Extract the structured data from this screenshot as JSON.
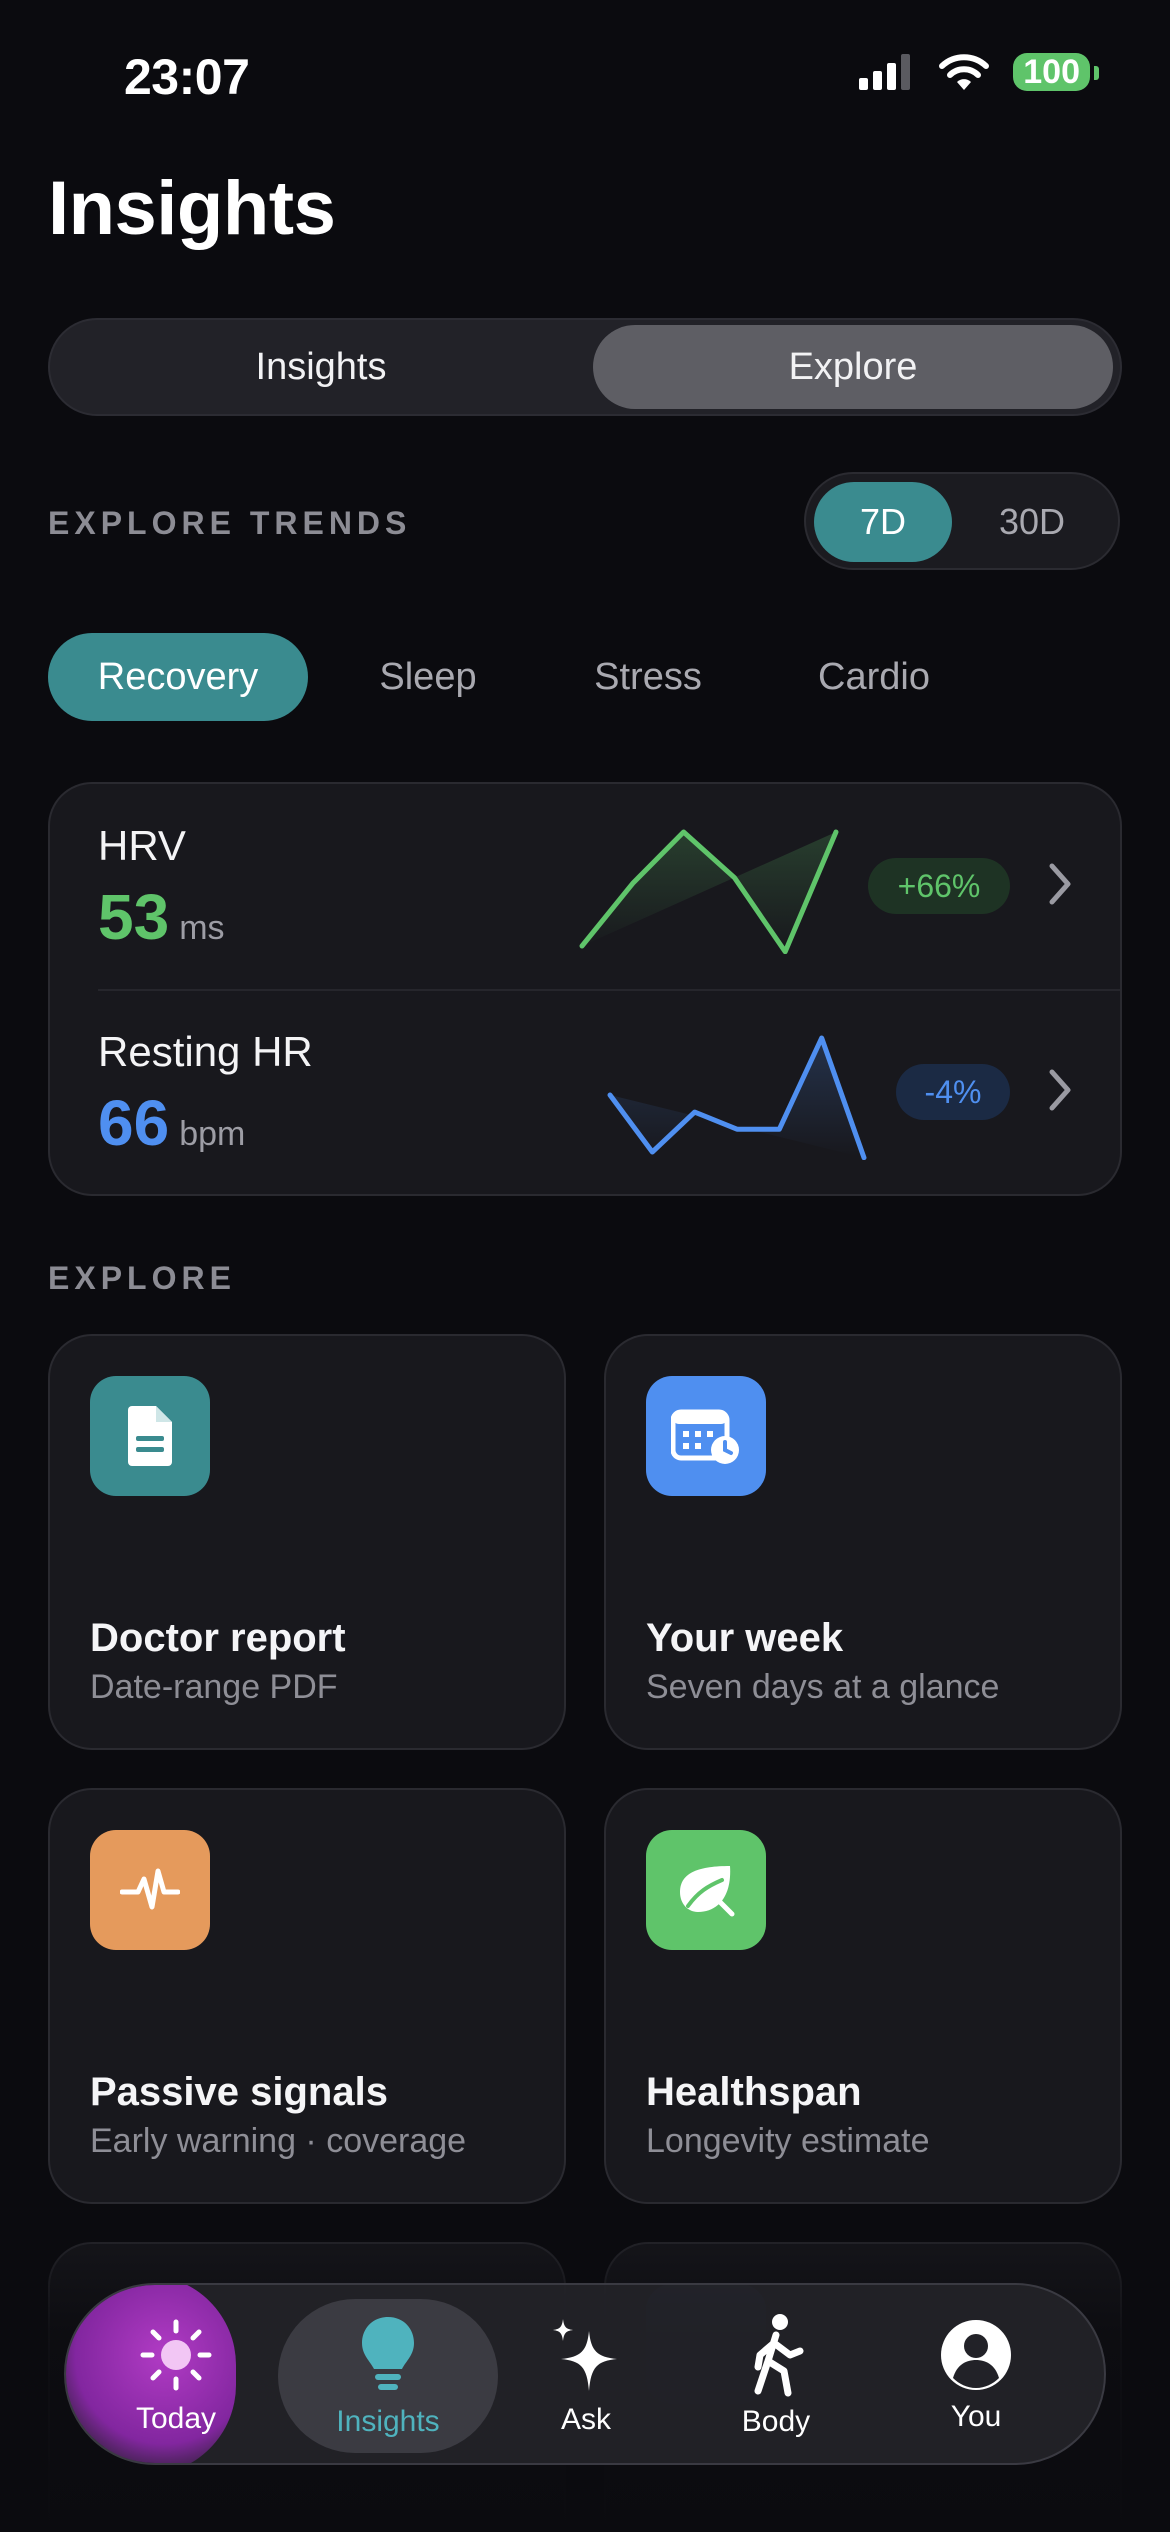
{
  "status": {
    "time": "23:07",
    "battery": "100"
  },
  "page": {
    "title": "Insights"
  },
  "segments": {
    "left": "Insights",
    "right": "Explore",
    "selected": "Explore"
  },
  "trends": {
    "label": "EXPLORE TRENDS",
    "ranges": [
      "7D",
      "30D"
    ],
    "selected_range": "7D",
    "chips": [
      "Recovery",
      "Sleep",
      "Stress",
      "Cardio"
    ],
    "selected_chip": "Recovery"
  },
  "metrics": [
    {
      "name": "HRV",
      "value": "53",
      "unit": "ms",
      "delta": "+66%",
      "color": "#5fc46a",
      "spark": [
        0.0,
        0.55,
        1.0,
        0.6,
        -0.05,
        1.0
      ]
    },
    {
      "name": "Resting HR",
      "value": "66",
      "unit": "bpm",
      "delta": "-4%",
      "color": "#4f8ff0",
      "spark": [
        0.5,
        0.0,
        0.35,
        0.2,
        0.2,
        1.0,
        -0.05
      ]
    }
  ],
  "explore": {
    "label": "EXPLORE",
    "tiles": [
      {
        "title": "Doctor report",
        "subtitle": "Date-range PDF",
        "icon": "document-icon",
        "color": "#3a8b8f"
      },
      {
        "title": "Your week",
        "subtitle": "Seven days at a glance",
        "icon": "calendar-clock-icon",
        "color": "#4f8ff0"
      },
      {
        "title": "Passive signals",
        "subtitle": "Early warning · coverage",
        "icon": "pulse-icon",
        "color": "#e59a5c"
      },
      {
        "title": "Healthspan",
        "subtitle": "Longevity estimate",
        "icon": "leaf-icon",
        "color": "#5fc46a"
      }
    ]
  },
  "tabbar": {
    "items": [
      {
        "label": "Today",
        "icon": "sun-icon"
      },
      {
        "label": "Insights",
        "icon": "lightbulb-icon"
      },
      {
        "label": "Ask",
        "icon": "sparkles-icon"
      },
      {
        "label": "Body",
        "icon": "walking-icon"
      },
      {
        "label": "You",
        "icon": "person-circle-icon"
      }
    ],
    "selected": "Insights",
    "accent": "#4fb3be"
  }
}
